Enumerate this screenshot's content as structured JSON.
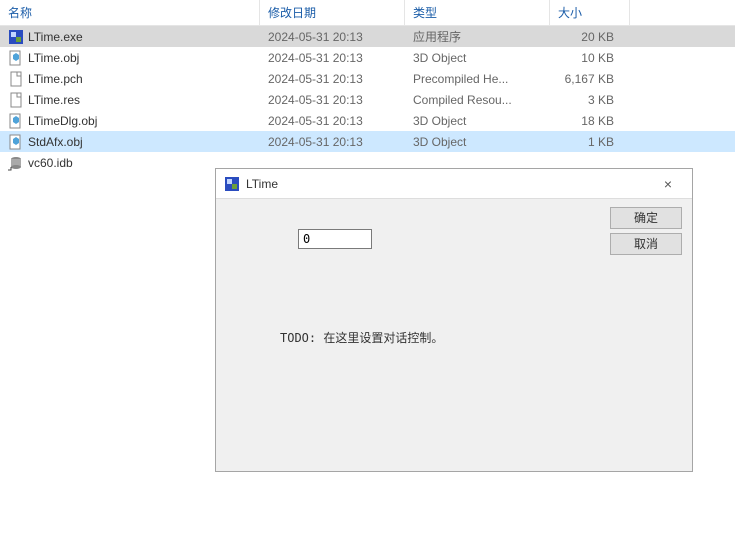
{
  "columns": {
    "name": "名称",
    "date": "修改日期",
    "type": "类型",
    "size": "大小"
  },
  "files": [
    {
      "icon": "app-icon",
      "name": "LTime.exe",
      "date": "2024-05-31 20:13",
      "type": "应用程序",
      "size": "20 KB",
      "selected": 1
    },
    {
      "icon": "3d-icon",
      "name": "LTime.obj",
      "date": "2024-05-31 20:13",
      "type": "3D Object",
      "size": "10 KB",
      "selected": 0
    },
    {
      "icon": "file-icon",
      "name": "LTime.pch",
      "date": "2024-05-31 20:13",
      "type": "Precompiled He...",
      "size": "6,167 KB",
      "selected": 0
    },
    {
      "icon": "file-icon",
      "name": "LTime.res",
      "date": "2024-05-31 20:13",
      "type": "Compiled Resou...",
      "size": "3 KB",
      "selected": 0
    },
    {
      "icon": "3d-icon",
      "name": "LTimeDlg.obj",
      "date": "2024-05-31 20:13",
      "type": "3D Object",
      "size": "18 KB",
      "selected": 0
    },
    {
      "icon": "3d-icon",
      "name": "StdAfx.obj",
      "date": "2024-05-31 20:13",
      "type": "3D Object",
      "size": "1 KB",
      "selected": 2
    },
    {
      "icon": "db-icon",
      "name": "vc60.idb",
      "date": "",
      "type": "",
      "size": "",
      "selected": 0
    }
  ],
  "dialog": {
    "title": "LTime",
    "ok_label": "确定",
    "cancel_label": "取消",
    "input_value": "0",
    "todo_text": "TODO: 在这里设置对话控制。",
    "close_symbol": "×"
  }
}
